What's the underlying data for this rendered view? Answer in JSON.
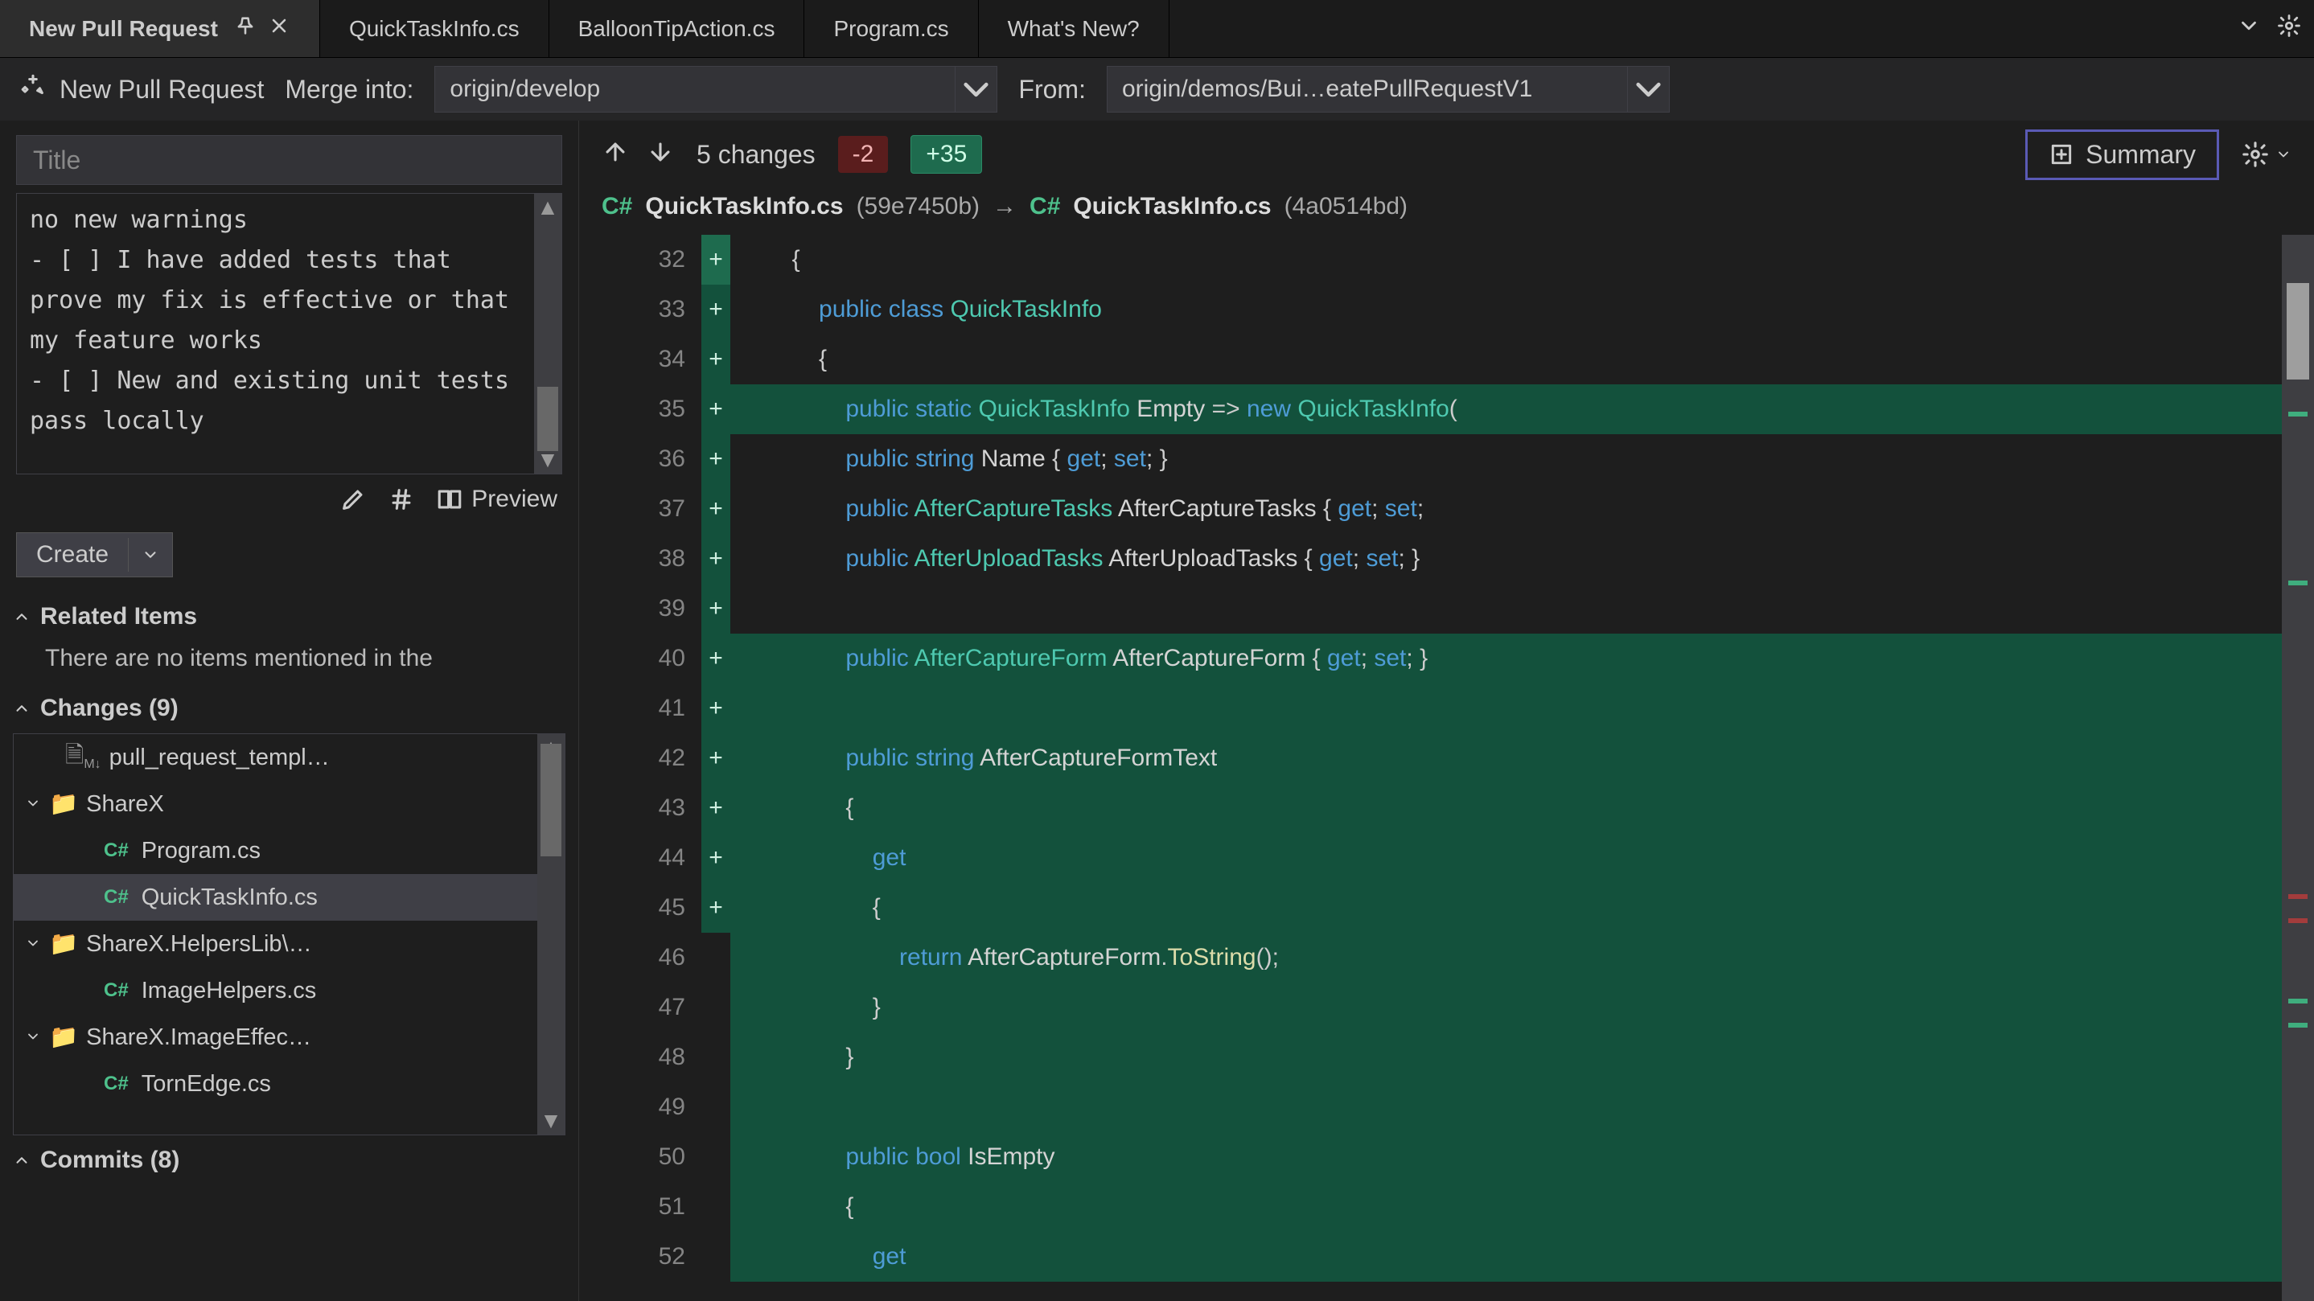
{
  "tabs": {
    "pinned": "New Pull Request",
    "items": [
      "QuickTaskInfo.cs",
      "BalloonTipAction.cs",
      "Program.cs",
      "What's New?"
    ]
  },
  "pr": {
    "title": "New Pull Request",
    "merge_label": "Merge into:",
    "merge_value": "origin/develop",
    "from_label": "From:",
    "from_value": "origin/demos/Bui…eatePullRequestV1",
    "title_placeholder": "Title",
    "description": "no new warnings\n- [ ] I have added tests that prove my fix is effective or that my feature works\n- [ ] New and existing unit tests pass locally",
    "preview_label": "Preview",
    "create_label": "Create"
  },
  "sections": {
    "related_label": "Related Items",
    "related_empty": "There are no items mentioned in the",
    "changes_label": "Changes (9)",
    "commits_label": "Commits (8)"
  },
  "tree": [
    {
      "depth": 0,
      "type": "file",
      "icon": "md",
      "label": "pull_request_templ…"
    },
    {
      "depth": 0,
      "type": "folder",
      "exp": true,
      "label": "ShareX"
    },
    {
      "depth": 1,
      "type": "cs",
      "label": "Program.cs"
    },
    {
      "depth": 1,
      "type": "cs",
      "label": "QuickTaskInfo.cs",
      "selected": true
    },
    {
      "depth": 0,
      "type": "folder",
      "exp": true,
      "label": "ShareX.HelpersLib\\…"
    },
    {
      "depth": 1,
      "type": "cs",
      "label": "ImageHelpers.cs"
    },
    {
      "depth": 0,
      "type": "folder",
      "exp": true,
      "label": "ShareX.ImageEffec…"
    },
    {
      "depth": 1,
      "type": "cs",
      "label": "TornEdge.cs"
    }
  ],
  "diff": {
    "changes_label": "5 changes",
    "deletions": "-2",
    "additions": "+35",
    "summary_label": "Summary",
    "left_file": "QuickTaskInfo.cs",
    "left_hash": "(59e7450b)",
    "right_file": "QuickTaskInfo.cs",
    "right_hash": "(4a0514bd)"
  },
  "code": [
    {
      "n": 32,
      "m": "",
      "cls": "",
      "html": "        {"
    },
    {
      "n": 33,
      "m": "",
      "cls": "",
      "html": "            <span class='kw'>public</span> <span class='kw'>class</span> <span class='tp'>QuickTaskInfo</span>"
    },
    {
      "n": 34,
      "m": "",
      "cls": "",
      "html": "            {"
    },
    {
      "n": 35,
      "m": "+",
      "cls": "added current",
      "html": "                <span class='kw'>public</span> <span class='kw'>static</span> <span class='tp'>QuickTaskInfo</span> <span class='id'>Empty</span> =&gt; <span class='kw'>new</span> <span class='tp'>QuickTaskInfo</span>("
    },
    {
      "n": 36,
      "m": "",
      "cls": "",
      "html": "                <span class='kw'>public</span> <span class='kw'>string</span> <span class='id'>Name</span> { <span class='kw'>get</span>; <span class='kw'>set</span>; }"
    },
    {
      "n": 37,
      "m": "",
      "cls": "",
      "html": "                <span class='kw'>public</span> <span class='tp'>AfterCaptureTasks</span> <span class='id'>AfterCaptureTasks</span> { <span class='kw'>get</span>; <span class='kw'>set</span>;"
    },
    {
      "n": 38,
      "m": "",
      "cls": "",
      "html": "                <span class='kw'>public</span> <span class='tp'>AfterUploadTasks</span> <span class='id'>AfterUploadTasks</span> { <span class='kw'>get</span>; <span class='kw'>set</span>; }"
    },
    {
      "n": 39,
      "m": "",
      "cls": "",
      "html": ""
    },
    {
      "n": 40,
      "m": "+",
      "cls": "added",
      "html": "                <span class='kw'>public</span> <span class='tp'>AfterCaptureForm</span> <span class='id'>AfterCaptureForm</span> { <span class='kw'>get</span>; <span class='kw'>set</span>; }"
    },
    {
      "n": 41,
      "m": "+",
      "cls": "added",
      "html": ""
    },
    {
      "n": 42,
      "m": "+",
      "cls": "added",
      "html": "                <span class='kw'>public</span> <span class='kw'>string</span> <span class='id'>AfterCaptureFormText</span>"
    },
    {
      "n": 43,
      "m": "+",
      "cls": "added",
      "html": "                {"
    },
    {
      "n": 44,
      "m": "+",
      "cls": "added",
      "html": "                    <span class='kw'>get</span>"
    },
    {
      "n": 45,
      "m": "+",
      "cls": "added",
      "html": "                    {"
    },
    {
      "n": 46,
      "m": "+",
      "cls": "added",
      "html": "                        <span class='kw'>return</span> <span class='id'>AfterCaptureForm</span>.<span class='fn2'>ToString</span>();"
    },
    {
      "n": 47,
      "m": "+",
      "cls": "added",
      "html": "                    }"
    },
    {
      "n": 48,
      "m": "+",
      "cls": "added",
      "html": "                }"
    },
    {
      "n": 49,
      "m": "+",
      "cls": "added",
      "html": ""
    },
    {
      "n": 50,
      "m": "+",
      "cls": "added",
      "html": "                <span class='kw'>public</span> <span class='kw'>bool</span> <span class='id'>IsEmpty</span>"
    },
    {
      "n": 51,
      "m": "+",
      "cls": "added",
      "html": "                {"
    },
    {
      "n": 52,
      "m": "+",
      "cls": "added",
      "html": "                    <span class='kw'>get</span>"
    }
  ]
}
